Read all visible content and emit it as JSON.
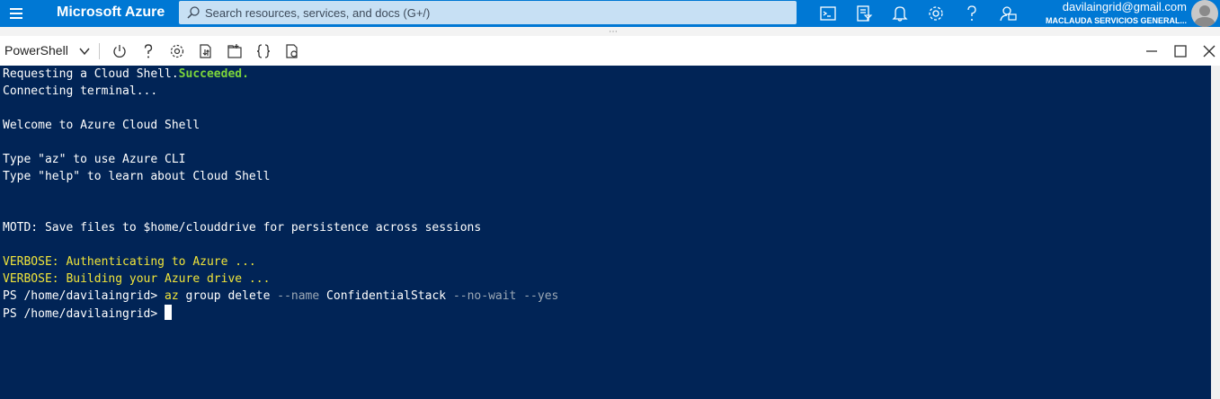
{
  "topbar": {
    "brand": "Microsoft Azure",
    "search_placeholder": "Search resources, services, and docs (G+/)",
    "icons": [
      "cloud-shell-icon",
      "directory-filter-icon",
      "notifications-icon",
      "settings-icon",
      "help-icon",
      "feedback-icon"
    ],
    "account": {
      "email": "davilaingrid@gmail.com",
      "org": "MACLAUDA SERVICIOS GENERAL..."
    }
  },
  "splitter": {
    "grip": "⋯"
  },
  "shellbar": {
    "shell_type": "PowerShell",
    "icons": [
      "restart-icon",
      "help-icon",
      "settings-icon",
      "upload-download-icon",
      "open-new-session-icon",
      "editor-braces-icon",
      "web-preview-icon"
    ],
    "window_icons": [
      "minimize-icon",
      "maximize-icon",
      "close-icon"
    ]
  },
  "terminal": {
    "l1_a": "Requesting a Cloud Shell.",
    "l1_b": "Succeeded.",
    "l2": "Connecting terminal...",
    "l3": "Welcome to Azure Cloud Shell",
    "l4": "Type \"az\" to use Azure CLI",
    "l5": "Type \"help\" to learn about Cloud Shell",
    "l6": "MOTD: Save files to $home/clouddrive for persistence across sessions",
    "l7": "VERBOSE: Authenticating to Azure ...",
    "l8": "VERBOSE: Building your Azure drive ...",
    "prompt": "PS /home/davilaingrid> ",
    "cmd_az": "az",
    "cmd_rest1": " group delete ",
    "cmd_name_flag": "--name",
    "cmd_name_val": " ConfidentialStack ",
    "cmd_nowait": "--no-wait",
    "cmd_yes": "--yes"
  },
  "colors": {
    "azure_blue": "#0078d4",
    "terminal_bg": "#012456",
    "success": "#7cd53b",
    "verbose": "#f0e43a"
  }
}
